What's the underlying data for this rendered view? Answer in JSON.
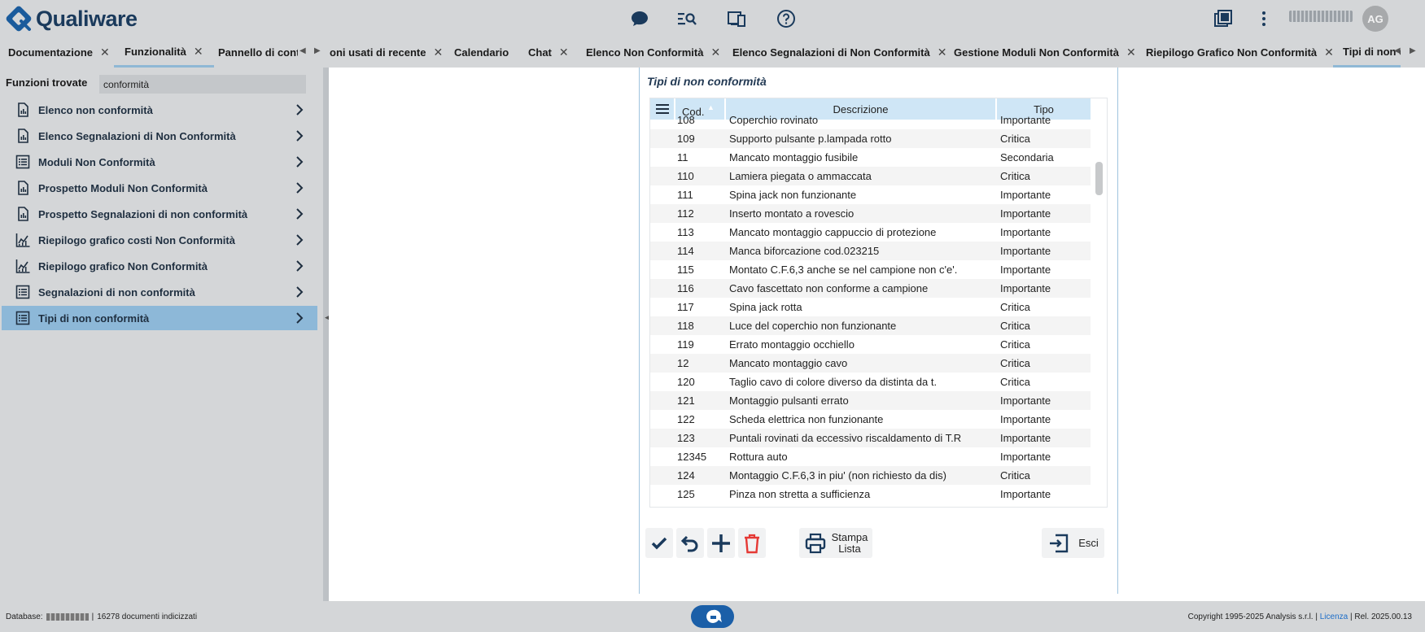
{
  "header": {
    "logo_text": "Qualiware",
    "avatar_initials": "AG",
    "icons": [
      "chat-icon",
      "search-list-icon",
      "devices-icon",
      "help-icon",
      "windows-icon",
      "more-vert-icon"
    ]
  },
  "tabs": [
    {
      "label": "Documentazione",
      "closable": true
    },
    {
      "label": "Funzionalità",
      "closable": true,
      "active": true
    },
    {
      "label": "Pannello di controllo",
      "closable": false
    },
    {
      "label": "oni usati di recente",
      "closable": true
    },
    {
      "label": "Calendario",
      "closable": false
    },
    {
      "label": "Chat",
      "closable": true
    },
    {
      "label": "Elenco Non Conformità",
      "closable": true
    },
    {
      "label": "Elenco Segnalazioni di Non Conformità",
      "closable": true
    },
    {
      "label": "Gestione Moduli Non Conformità",
      "closable": true
    },
    {
      "label": "Riepilogo Grafico Non Conformità",
      "closable": true
    },
    {
      "label": "Tipi di non c",
      "closable": false,
      "active": true
    }
  ],
  "search": {
    "label": "Funzioni trovate",
    "value": "conformità"
  },
  "menu": [
    {
      "label": "Elenco non conformità",
      "icon": "report-icon"
    },
    {
      "label": "Elenco Segnalazioni di Non Conformità",
      "icon": "report-icon"
    },
    {
      "label": "Moduli Non Conformità",
      "icon": "list-icon"
    },
    {
      "label": "Prospetto Moduli Non Conformità",
      "icon": "report-icon"
    },
    {
      "label": "Prospetto Segnalazioni di non conformità",
      "icon": "report-icon"
    },
    {
      "label": "Riepilogo grafico costi Non Conformità",
      "icon": "chart-icon"
    },
    {
      "label": "Riepilogo grafico Non Conformità",
      "icon": "chart-icon"
    },
    {
      "label": "Segnalazioni di non conformità",
      "icon": "list-icon"
    },
    {
      "label": "Tipi di non conformità",
      "icon": "list-icon",
      "selected": true
    }
  ],
  "form": {
    "title": "Tipi di non conformità",
    "columns": {
      "cod": "Cod.",
      "descrizione": "Descrizione",
      "tipo": "Tipo"
    },
    "rows": [
      {
        "cod": "108",
        "descrizione": "Coperchio rovinato",
        "tipo": "Importante"
      },
      {
        "cod": "109",
        "descrizione": "Supporto pulsante p.lampada rotto",
        "tipo": "Critica"
      },
      {
        "cod": "11",
        "descrizione": "Mancato montaggio fusibile",
        "tipo": "Secondaria"
      },
      {
        "cod": "110",
        "descrizione": "Lamiera piegata o ammaccata",
        "tipo": "Critica"
      },
      {
        "cod": "111",
        "descrizione": "Spina jack non funzionante",
        "tipo": "Importante"
      },
      {
        "cod": "112",
        "descrizione": "Inserto montato a rovescio",
        "tipo": "Importante"
      },
      {
        "cod": "113",
        "descrizione": "Mancato montaggio cappuccio di protezione",
        "tipo": "Importante"
      },
      {
        "cod": "114",
        "descrizione": "Manca biforcazione cod.023215",
        "tipo": "Importante"
      },
      {
        "cod": "115",
        "descrizione": "Montato C.F.6,3 anche se nel campione non c'e'.",
        "tipo": "Importante"
      },
      {
        "cod": "116",
        "descrizione": "Cavo  fascettato  non conforme a campione",
        "tipo": "Importante"
      },
      {
        "cod": "117",
        "descrizione": "Spina jack rotta",
        "tipo": "Critica"
      },
      {
        "cod": "118",
        "descrizione": "Luce del coperchio non funzionante",
        "tipo": "Critica"
      },
      {
        "cod": "119",
        "descrizione": "Errato montaggio occhiello",
        "tipo": "Critica"
      },
      {
        "cod": "12",
        "descrizione": "Mancato montaggio cavo",
        "tipo": "Critica"
      },
      {
        "cod": "120",
        "descrizione": "Taglio cavo di colore diverso da distinta da t.",
        "tipo": "Critica"
      },
      {
        "cod": "121",
        "descrizione": "Montaggio pulsanti errato",
        "tipo": "Importante"
      },
      {
        "cod": "122",
        "descrizione": "Scheda elettrica non funzionante",
        "tipo": "Importante"
      },
      {
        "cod": "123",
        "descrizione": "Puntali rovinati da eccessivo riscaldamento di T.R",
        "tipo": "Importante"
      },
      {
        "cod": "12345",
        "descrizione": "Rottura auto",
        "tipo": "Importante"
      },
      {
        "cod": "124",
        "descrizione": "Montaggio  C.F.6,3  in piu' (non richiesto da dis)",
        "tipo": "Critica"
      },
      {
        "cod": "125",
        "descrizione": "Pinza non stretta a sufficienza",
        "tipo": "Importante"
      }
    ],
    "buttons": {
      "print_line1": "Stampa",
      "print_line2": "Lista",
      "exit": "Esci"
    }
  },
  "footer": {
    "database_label": "Database:",
    "documents": "16278 documenti indicizzati",
    "copyright": "Copyright 1995-2025 Analysis s.r.l. |",
    "license": "Licenza",
    "release": "| Rel.  2025.00.13"
  },
  "colors": {
    "brand": "#1a3a5c",
    "accent": "#8db8d8",
    "grid_header": "#cfe6f6",
    "delete": "#e53935",
    "chat_button": "#1b5fa8"
  }
}
